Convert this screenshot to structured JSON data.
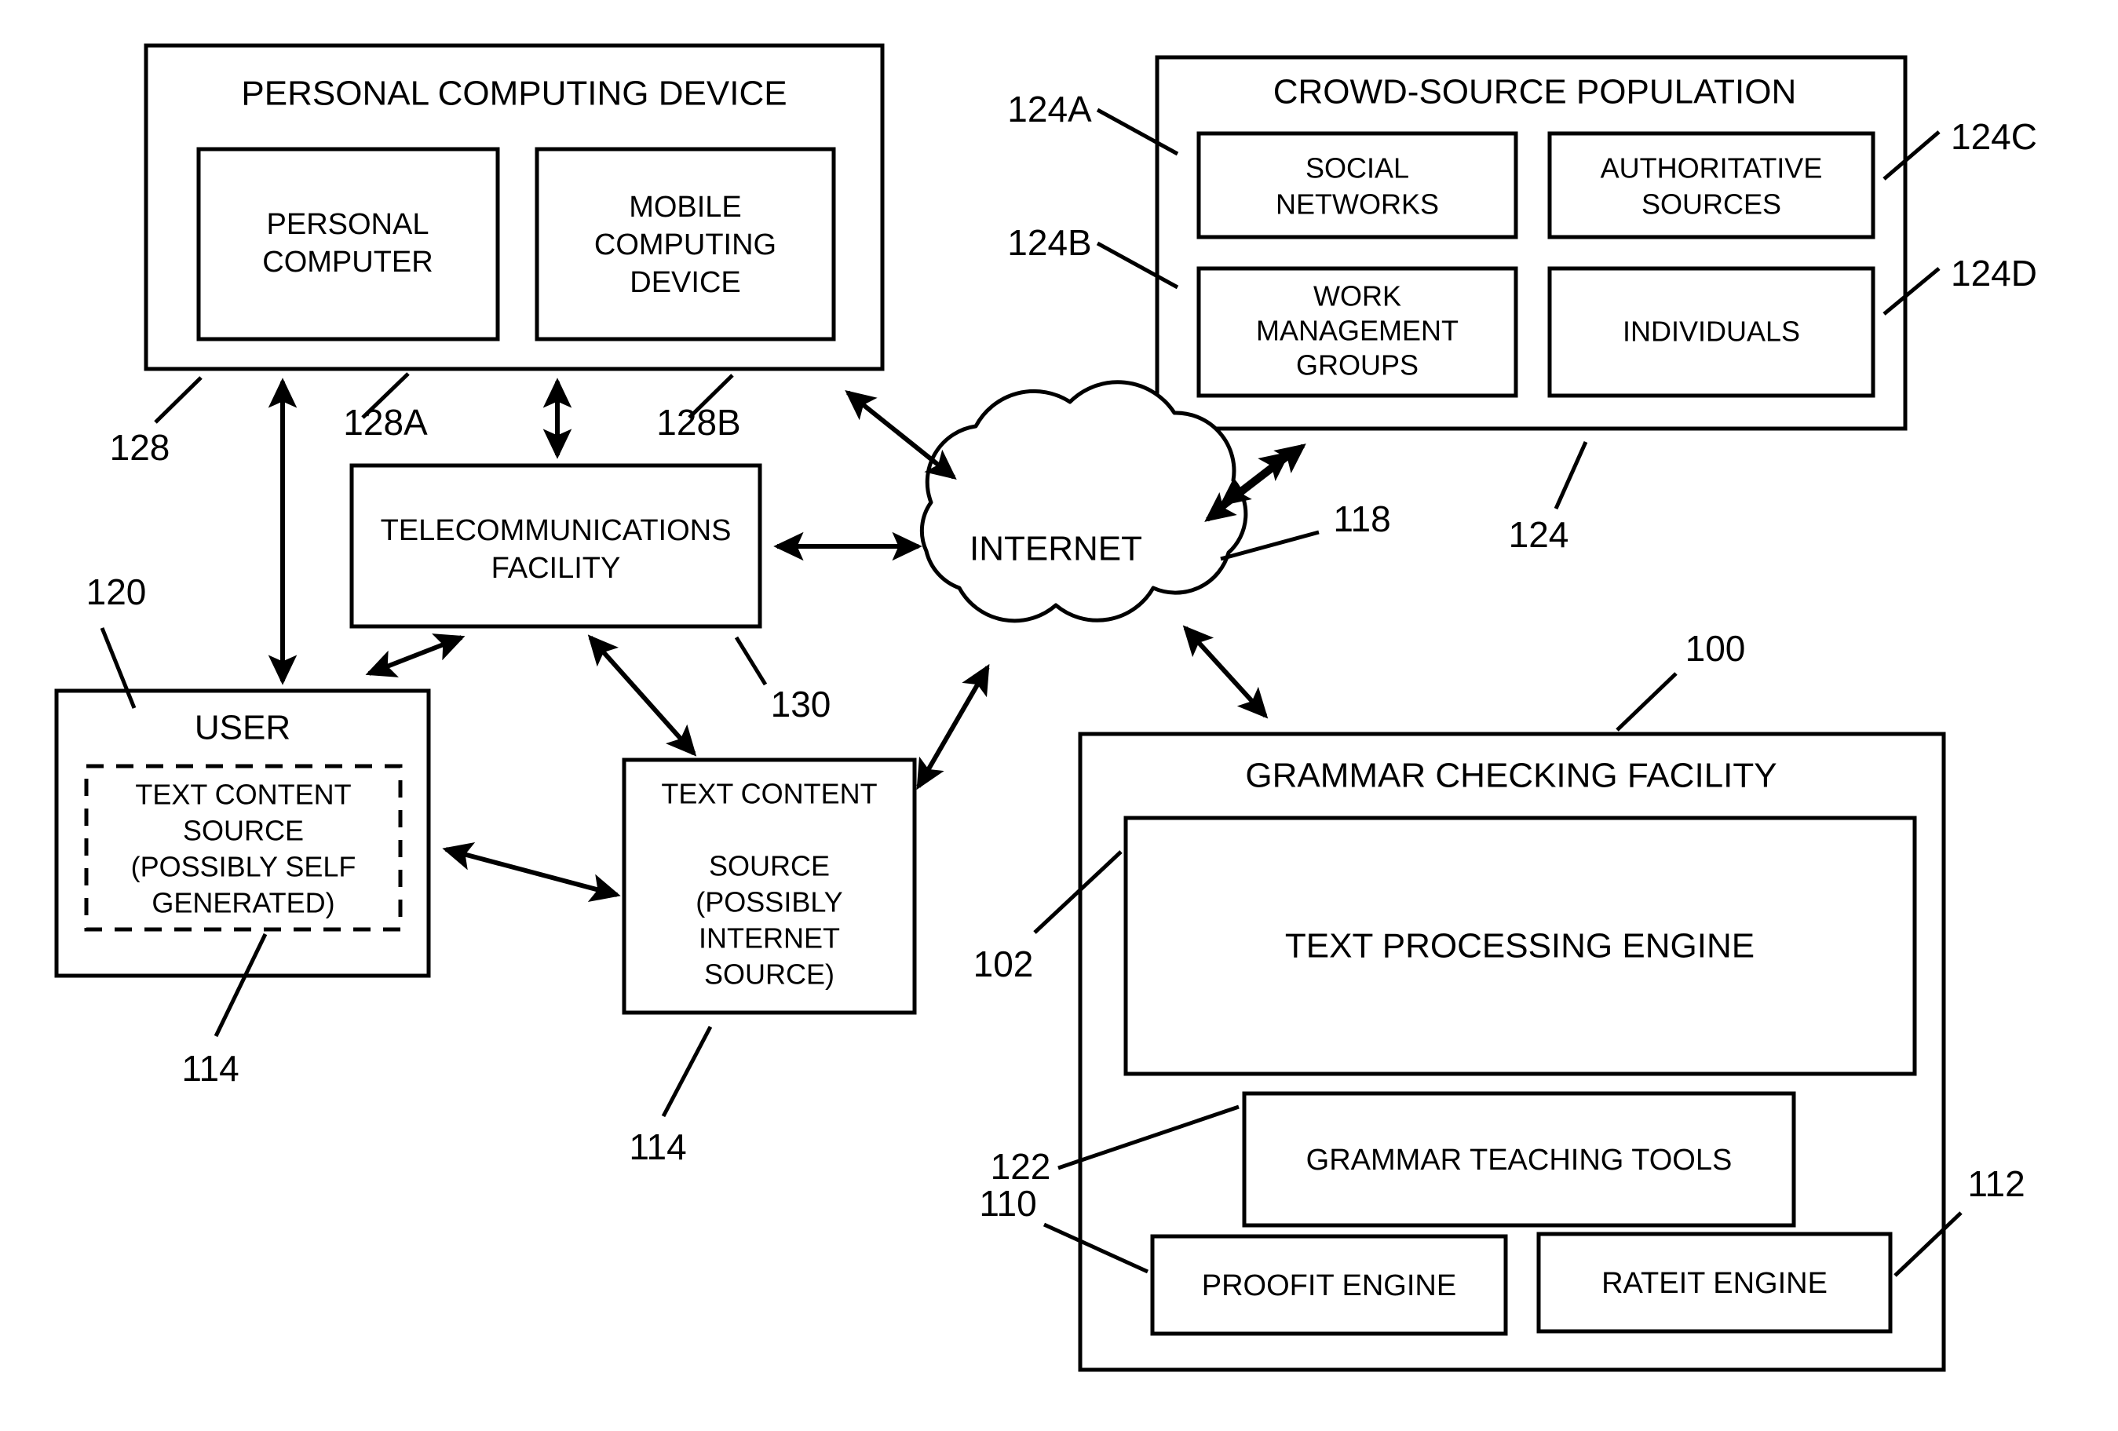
{
  "figure": {
    "type": "patent-block-diagram",
    "background_color": "#ffffff",
    "line_color": "#000000"
  },
  "blocks": {
    "personal_computing_device": {
      "title": "PERSONAL COMPUTING DEVICE",
      "children": [
        {
          "label": "PERSONAL COMPUTER"
        },
        {
          "label": "MOBILE COMPUTING DEVICE"
        }
      ]
    },
    "crowd_source_population": {
      "title": "CROWD-SOURCE POPULATION",
      "children": [
        {
          "label": "SOCIAL NETWORKS"
        },
        {
          "label": "AUTHORITATIVE SOURCES"
        },
        {
          "label": "WORK MANAGEMENT GROUPS"
        },
        {
          "label": "INDIVIDUALS"
        }
      ]
    },
    "telecommunications_facility": {
      "title": "TELECOMMUNICATIONS FACILITY"
    },
    "internet_cloud": {
      "title": "INTERNET"
    },
    "user": {
      "title": "USER",
      "inner_label_lines": [
        "TEXT CONTENT",
        "SOURCE",
        "(POSSIBLY SELF",
        "GENERATED)"
      ]
    },
    "text_content_source_internet": {
      "label_lines": [
        "TEXT CONTENT",
        "",
        "SOURCE",
        "(POSSIBLY",
        "INTERNET",
        "SOURCE)"
      ]
    },
    "grammar_checking_facility": {
      "title": "GRAMMAR CHECKING FACILITY",
      "children": [
        {
          "label": "TEXT PROCESSING ENGINE"
        },
        {
          "label": "GRAMMAR TEACHING TOOLS"
        },
        {
          "label": "PROOFIT ENGINE"
        },
        {
          "label": "RATEIT ENGINE"
        }
      ]
    }
  },
  "reference_numerals": {
    "personal_computing_device": "128",
    "personal_computer": "128A",
    "mobile_computing_device": "128B",
    "user": "120",
    "user_text_content_source": "114",
    "text_content_source_internet": "114",
    "telecommunications_facility": "130",
    "internet": "118",
    "crowd_source_population": "124",
    "social_networks": "124A",
    "work_management_groups": "124B",
    "authoritative_sources": "124C",
    "individuals": "124D",
    "grammar_checking_facility": "100",
    "text_processing_engine": "102",
    "grammar_teaching_tools": "122",
    "proofit_engine": "110",
    "rateit_engine": "112"
  }
}
